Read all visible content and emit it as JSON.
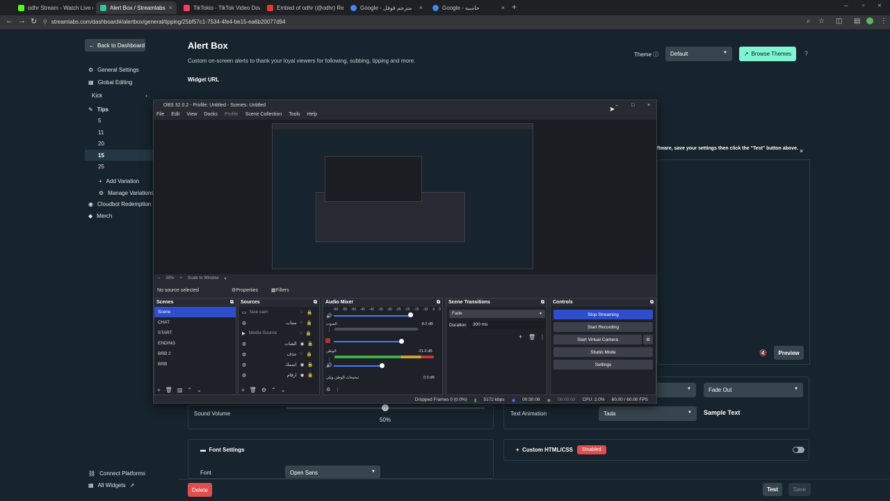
{
  "browser": {
    "tabs": [
      {
        "label": "odhr Stream - Watch Live on K",
        "color": "#53fc18"
      },
      {
        "label": "Alert Box / Streamlabs",
        "color": "#31c3a2"
      },
      {
        "label": "TikTokio - TikTok Video Downlo",
        "color": "#ff3b5c"
      },
      {
        "label": "Embed of odhr (@odhr) Realti",
        "color": "#e53935"
      },
      {
        "label": "Google - مترجم قوقل",
        "color": "#4285f4"
      },
      {
        "label": "Google - حاسبه",
        "color": "#4285f4"
      }
    ],
    "new_tab_glyph": "+",
    "url": "streamlabs.com/dashboard#/alertbox/general/tipping/25bf57c1-7534-4fe4-be15-ea6b20077d94"
  },
  "sidebar": {
    "back_label": "Back to Dashboard",
    "items": [
      {
        "label": "General Settings",
        "icon": "gear-icon"
      },
      {
        "label": "Global Editing",
        "icon": "grid-icon"
      },
      {
        "label": "Kick",
        "icon": ""
      },
      {
        "label": "Tips",
        "icon": "tip-icon"
      },
      {
        "label": "5"
      },
      {
        "label": "11"
      },
      {
        "label": "20"
      },
      {
        "label": "15"
      },
      {
        "label": "25"
      },
      {
        "label": "Add Variation",
        "icon": "plus-icon"
      },
      {
        "label": "Manage Variations",
        "icon": "gear-icon"
      },
      {
        "label": "Cloudbot Redemption",
        "icon": "cloudbot-icon"
      },
      {
        "label": "Merch",
        "icon": "merch-icon"
      },
      {
        "label": "Connect Platforms",
        "icon": "link-icon"
      },
      {
        "label": "All Widgets",
        "icon": "grid-icon"
      }
    ]
  },
  "main": {
    "title": "Alert Box",
    "description": "Custom on-screen alerts to thank your loyal viewers for following, subbing, tipping and more.",
    "widget_url_label": "Widget URL",
    "theme_label": "Theme",
    "theme_value": "Default",
    "browse_themes": "Browse Themes",
    "notice": "ftware, save your settings then click the \"Test\" button above.",
    "preview": "Preview",
    "fade_out": "Fade Out",
    "sound_volume_label": "Sound Volume",
    "sound_volume_value": "50%",
    "sound_volume": 0.5,
    "text_animation_label": "Text Animation",
    "text_animation_value": "Tada",
    "sample_text": "Sample Text",
    "font_settings": "Font Settings",
    "font_label": "Font",
    "font_value": "Open Sans",
    "custom_html": "Custom HTML/CSS",
    "disabled": "Disabled",
    "delete": "Delete",
    "test": "Test",
    "save": "Save"
  },
  "obs": {
    "title": "OBS 32.0.2 - Profile: Untitled - Scenes: Untitled",
    "menu": [
      "File",
      "Edit",
      "View",
      "Docks",
      "Profile",
      "Scene Collection",
      "Tools",
      "Help"
    ],
    "zoom": "39%",
    "scale_mode": "Scale to Window",
    "no_source": "No source selected",
    "properties": "Properties",
    "filters": "Filters",
    "docks": {
      "scenes": "Scenes",
      "sources": "Sources",
      "audio_mixer": "Audio Mixer",
      "transitions": "Scene Transitions",
      "controls": "Controls"
    },
    "scenes": [
      "Scene",
      "CHAT",
      "START",
      "ENDING",
      "BRB 2",
      "BRB"
    ],
    "sources": [
      "face cam",
      "سناب",
      "Media Source",
      "الشات",
      "حذف",
      "اسمك",
      "ارقام"
    ],
    "mixer": {
      "ticks": [
        "-60",
        "-55",
        "-50",
        "-45",
        "-40",
        "-35",
        "-30",
        "-25",
        "-20",
        "-15",
        "-10",
        "-5",
        "0"
      ],
      "channels": [
        {
          "name": "الصوت",
          "db": "-8.2 dB"
        },
        {
          "name": "الوطن",
          "db": "-21.0 dB"
        },
        {
          "name": "تبخيحات الوطن ويلي",
          "db": "0.0 dB"
        }
      ]
    },
    "transition": "Fade",
    "duration_label": "Duration",
    "duration_value": "300 ms",
    "controls": [
      "Stop Streaming",
      "Start Recording",
      "Start Virtual Camera",
      "Studio Mode",
      "Settings"
    ],
    "status": {
      "dropped": "Dropped Frames 0 (0.0%)",
      "kbps": "5172 kbps",
      "stream_time": "00:30:08",
      "rec_time": "00:00:00",
      "cpu": "CPU: 2.0%",
      "fps": "60.00 / 60.00 FPS"
    }
  }
}
